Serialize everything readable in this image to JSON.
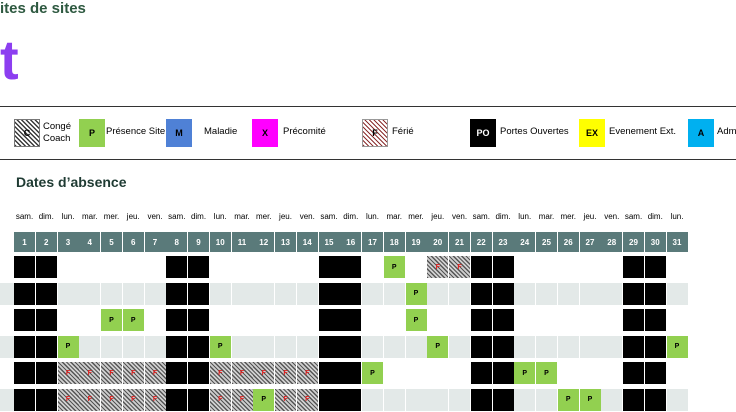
{
  "header": {
    "title": "ites de sites",
    "big_letter": "t"
  },
  "legend": [
    {
      "code": "C",
      "label": "Congé Coach",
      "label_lines": [
        "Congé",
        "Coach"
      ],
      "style": "hatch-dark",
      "color": ""
    },
    {
      "code": "P",
      "label": "Présence Site",
      "style": "solid",
      "color": "#92d050"
    },
    {
      "code": "M",
      "label": "Maladie",
      "style": "solid",
      "color": "#4f81d6"
    },
    {
      "code": "X",
      "label": "Précomité",
      "style": "solid",
      "color": "#ff00ff"
    },
    {
      "code": "F",
      "label": "Férié",
      "style": "hatch-red",
      "color": ""
    },
    {
      "code": "PO",
      "label": "Portes Ouvertes",
      "style": "solid",
      "color": "#000000",
      "text_color": "#ffffff"
    },
    {
      "code": "EX",
      "label": "Evenement Ext.",
      "style": "solid",
      "color": "#ffff00"
    },
    {
      "code": "A",
      "label": "Adm",
      "style": "solid",
      "color": "#00b0f0"
    }
  ],
  "section_title": "Dates d’absence",
  "calendar": {
    "days_of_week": [
      "sam.",
      "dim.",
      "lun.",
      "mar.",
      "mer.",
      "jeu.",
      "ven.",
      "sam.",
      "dim.",
      "lun.",
      "mar.",
      "mer.",
      "jeu.",
      "ven.",
      "sam.",
      "dim.",
      "lun.",
      "mar.",
      "mer.",
      "jeu.",
      "ven.",
      "sam.",
      "dim.",
      "lun.",
      "mar.",
      "mer.",
      "jeu.",
      "ven.",
      "sam.",
      "dim.",
      "lun."
    ],
    "day_numbers": [
      "1",
      "2",
      "3",
      "4",
      "5",
      "6",
      "7",
      "8",
      "9",
      "10",
      "11",
      "12",
      "13",
      "14",
      "15",
      "16",
      "17",
      "18",
      "19",
      "20",
      "21",
      "22",
      "23",
      "24",
      "25",
      "26",
      "27",
      "28",
      "29",
      "30",
      "31"
    ],
    "weekend_indices": [
      0,
      1,
      7,
      8,
      14,
      15,
      21,
      22,
      28,
      29
    ],
    "rows": [
      {
        "marks": {
          "17": "P",
          "19": "F",
          "20": "F"
        }
      },
      {
        "marks": {
          "18": "P"
        }
      },
      {
        "marks": {
          "4": "P",
          "5": "P",
          "18": "P"
        }
      },
      {
        "marks": {
          "2": "P",
          "9": "P",
          "19": "P",
          "30": "P"
        }
      },
      {
        "marks": {
          "2": "F",
          "3": "F",
          "4": "F",
          "5": "F",
          "6": "F",
          "9": "F",
          "10": "F",
          "11": "F",
          "12": "F",
          "13": "F",
          "16": "P",
          "23": "P",
          "24": "P"
        }
      },
      {
        "marks": {
          "2": "F",
          "3": "F",
          "4": "F",
          "5": "F",
          "6": "F",
          "9": "F",
          "10": "F",
          "11": "P",
          "12": "F",
          "13": "F",
          "25": "P",
          "26": "P"
        }
      }
    ]
  }
}
